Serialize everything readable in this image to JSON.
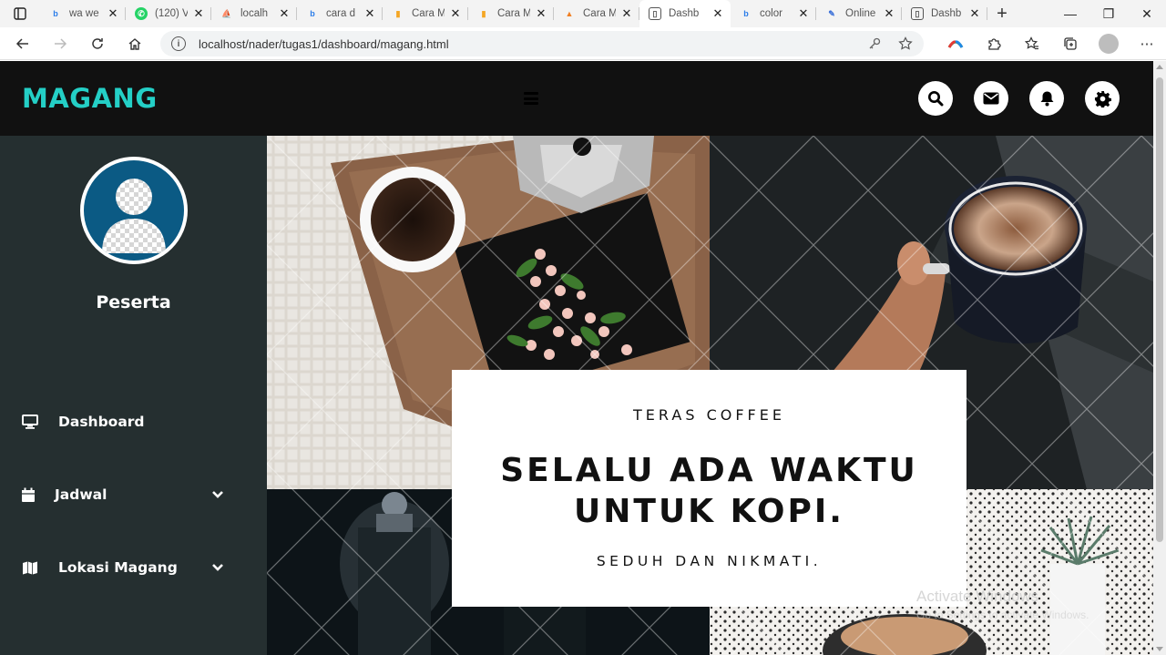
{
  "browser": {
    "tabs": [
      {
        "label": "wa we",
        "favicon": "bing-icon",
        "color": "#2b7de9",
        "active": false
      },
      {
        "label": "(120) V",
        "favicon": "whatsapp-icon",
        "color": "#25d366",
        "active": false
      },
      {
        "label": "localh",
        "favicon": "phpmyadmin-icon",
        "color": "#f29111",
        "active": false
      },
      {
        "label": "cara d",
        "favicon": "bing-icon",
        "color": "#2b7de9",
        "active": false
      },
      {
        "label": "Cara M",
        "favicon": "bookmark-icon",
        "color": "#f5a623",
        "active": false
      },
      {
        "label": "Cara M",
        "favicon": "bookmark-icon",
        "color": "#f5a623",
        "active": false
      },
      {
        "label": "Cara M",
        "favicon": "fox-icon",
        "color": "#f07f22",
        "active": false
      },
      {
        "label": "Dashb",
        "favicon": "page-icon",
        "color": "#555555",
        "active": true
      },
      {
        "label": "color",
        "favicon": "bing-icon",
        "color": "#2b7de9",
        "active": false
      },
      {
        "label": "Online",
        "favicon": "eyedropper-icon",
        "color": "#3a6fd8",
        "active": false
      },
      {
        "label": "Dashb",
        "favicon": "page-icon",
        "color": "#555555",
        "active": false
      }
    ],
    "url": "localhost/nader/tugas1/dashboard/magang.html"
  },
  "header": {
    "brand": "MAGANG",
    "brand_color": "#24cfc6",
    "icons": [
      "search-icon",
      "envelope-icon",
      "bell-icon",
      "gear-icon"
    ]
  },
  "sidebar": {
    "role": "Peserta",
    "items": [
      {
        "label": "Dashboard",
        "icon": "monitor-icon",
        "has_submenu": false
      },
      {
        "label": "Jadwal",
        "icon": "calendar-icon",
        "has_submenu": true
      },
      {
        "label": "Lokasi Magang",
        "icon": "map-icon",
        "has_submenu": true
      }
    ]
  },
  "hero": {
    "kicker": "TERAS COFFEE",
    "headline_line1": "SELALU ADA WAKTU",
    "headline_line2": "UNTUK KOPI.",
    "sub": "SEDUH DAN NIKMATI."
  },
  "watermark": {
    "title": "Activate Windows",
    "subtitle": "Go to Settings to activate Windows."
  }
}
